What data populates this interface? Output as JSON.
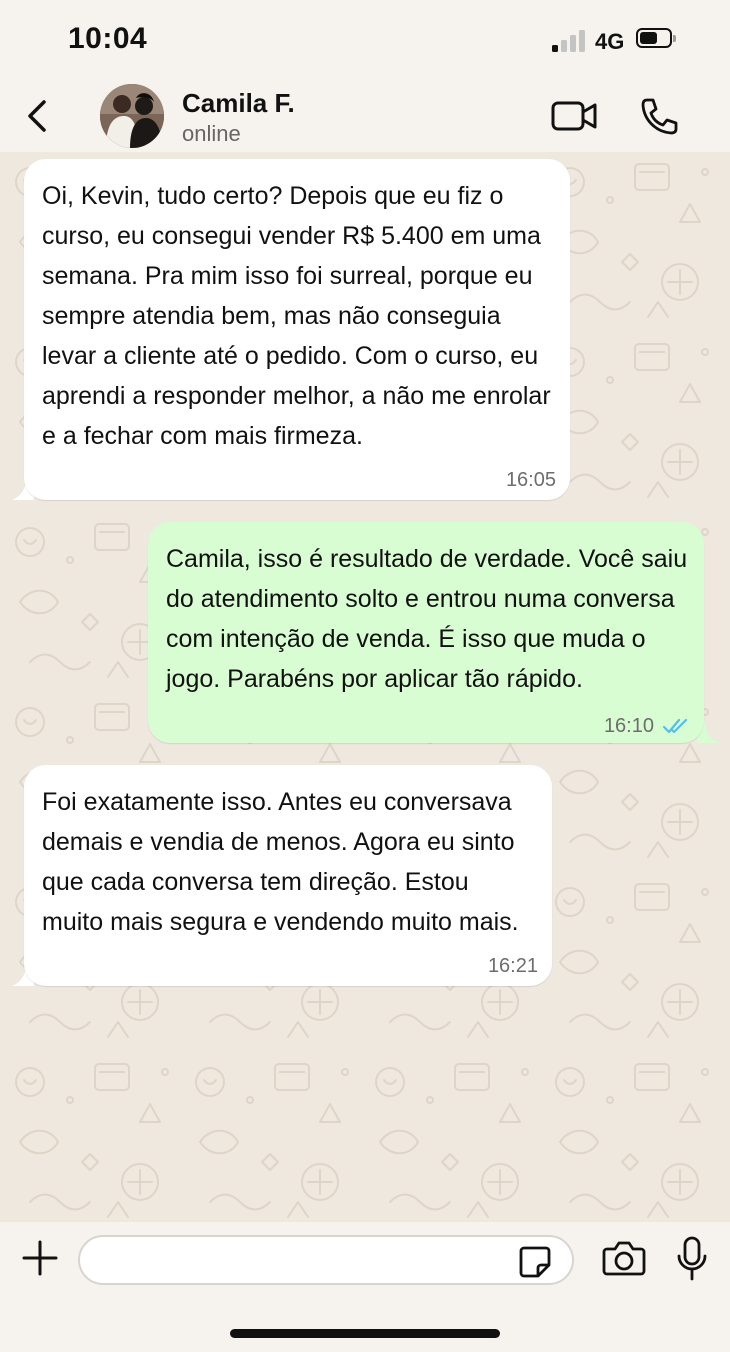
{
  "status_bar": {
    "time": "10:04",
    "network": "4G",
    "signal_bars_active": 1,
    "signal_bars_total": 4,
    "battery_level": 0.6,
    "icons": [
      "signal-icon",
      "battery-icon"
    ]
  },
  "header": {
    "contact_name": "Camila F.",
    "contact_status": "online",
    "icons": [
      "back-chevron-icon",
      "avatar",
      "video-camera-icon",
      "phone-icon"
    ]
  },
  "messages": [
    {
      "direction": "in",
      "text": "Oi, Kevin, tudo certo? Depois que eu fiz o curso, eu consegui vender R$ 5.400 em uma semana. Pra mim isso foi surreal, porque eu sempre atendia bem, mas não conseguia levar a cliente até o pedido. Com o curso, eu aprendi a responder melhor, a não me enrolar e a fechar com mais firmeza.",
      "time": "16:05"
    },
    {
      "direction": "out",
      "text": "Camila, isso é resultado de verdade. Você saiu do atendimento solto e entrou numa conversa com intenção de venda. É isso que muda o jogo. Parabéns por aplicar tão rápido.",
      "time": "16:10",
      "status": "read",
      "status_icon": "double-check-icon"
    },
    {
      "direction": "in",
      "text": "Foi exatamente isso. Antes eu conversava demais e vendia de menos. Agora eu sinto que cada conversa tem direção. Estou muito mais segura e vendendo muito mais.",
      "time": "16:21"
    }
  ],
  "input_bar": {
    "message_placeholder": "",
    "message_value": "",
    "icons": [
      "plus-icon",
      "sticker-icon",
      "camera-icon",
      "microphone-icon"
    ]
  },
  "colors": {
    "background": "#f6f3ee",
    "chat_wallpaper": "#efe8de",
    "incoming_bubble": "#ffffff",
    "outgoing_bubble": "#d9fdd3",
    "read_receipt": "#53bdeb",
    "timestamp": "#6d6d6d"
  }
}
